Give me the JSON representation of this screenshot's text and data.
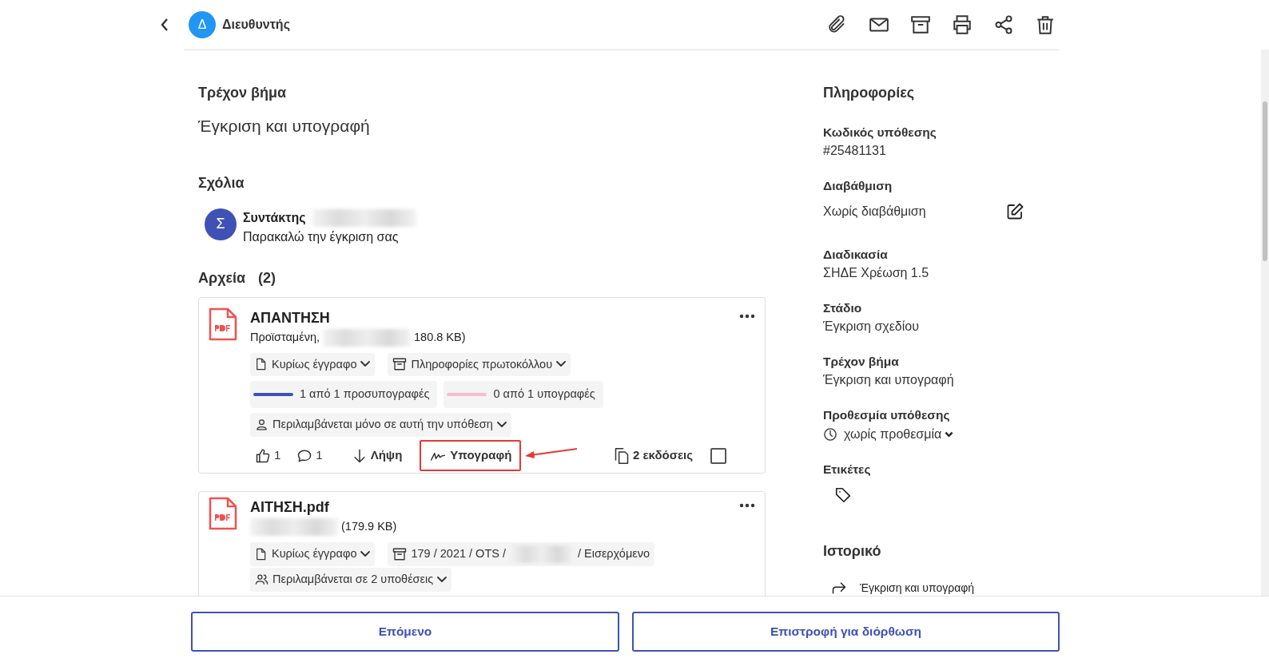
{
  "header": {
    "avatar_letter": "Δ",
    "title": "Διευθυντής"
  },
  "current_step": {
    "heading": "Τρέχον βήμα",
    "value": "Έγκριση και υπογραφή"
  },
  "comments": {
    "heading": "Σχόλια",
    "items": [
      {
        "avatar_letter": "Σ",
        "author": "Συντάκτης",
        "text": "Παρακαλώ την έγκριση σας"
      }
    ]
  },
  "files": {
    "heading": "Αρχεία",
    "count": "(2)",
    "items": [
      {
        "name": "ΑΠΑΝΤΗΣΗ",
        "meta": [
          {
            "kind": "text",
            "text": "Προϊσταμένη,"
          },
          {
            "kind": "blur"
          },
          {
            "kind": "text",
            "text": "180.8 KB)"
          }
        ],
        "doc_type": "Κυρίως έγγραφο",
        "protocol": {
          "parts": [
            {
              "kind": "text",
              "text": "Πληροφορίες πρωτοκόλλου"
            }
          ],
          "dropdown": true
        },
        "progress": [
          {
            "text": "1 από 1 προσυπογραφές",
            "level": 1
          },
          {
            "text": "0 από 1 υπογραφές",
            "level": 0
          }
        ],
        "inclusion": {
          "kind": "single",
          "text": "Περιλαμβάνεται μόνο σε αυτή την υπόθεση"
        },
        "likes": "1",
        "comment_count": "1",
        "download": "Λήψη",
        "sign": {
          "label": "Υπογραφή",
          "highlighted": true
        },
        "versions": "2 εκδόσεις",
        "checked": false
      },
      {
        "name": "ΑΙΤΗΣΗ.pdf",
        "meta": [
          {
            "kind": "blur"
          },
          {
            "kind": "text",
            "text": "(179.9 KB)"
          }
        ],
        "doc_type": "Κυρίως έγγραφο",
        "protocol": {
          "parts": [
            {
              "kind": "text",
              "text": "179 / 2021 / OTS /"
            },
            {
              "kind": "blur"
            },
            {
              "kind": "text",
              "text": "/ Εισερχόμενο"
            }
          ],
          "dropdown": false
        },
        "inclusion": {
          "kind": "multiple",
          "text": "Περιλαμβάνεται σε 2 υποθέσεις"
        }
      }
    ]
  },
  "info": {
    "heading": "Πληροφορίες",
    "fields": [
      {
        "kind": "text",
        "label": "Κωδικός υπόθεσης",
        "value": "#25481131"
      },
      {
        "kind": "editable",
        "label": "Διαβάθμιση",
        "value": "Χωρίς διαβάθμιση"
      },
      {
        "kind": "text",
        "label": "Διαδικασία",
        "value": "ΣΗΔΕ Χρέωση 1.5"
      },
      {
        "kind": "text",
        "label": "Στάδιο",
        "value": "Έγκριση σχεδίου"
      },
      {
        "kind": "text",
        "label": "Τρέχον βήμα",
        "value": "Έγκριση και υπογραφή"
      },
      {
        "kind": "deadline",
        "label": "Προθεσμία υπόθεσης",
        "value": "χωρίς προθεσμία"
      },
      {
        "kind": "tags",
        "label": "Ετικέτες"
      }
    ]
  },
  "history": {
    "heading": "Ιστορικό",
    "items": [
      {
        "text": "Έγκριση και υπογραφή"
      }
    ]
  },
  "footer_buttons": [
    "Επόμενο",
    "Επιστροφή για διόρθωση"
  ]
}
